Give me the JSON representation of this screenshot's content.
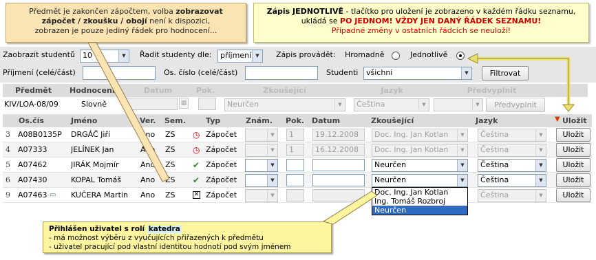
{
  "callout_left": {
    "line1a": "Předmět je zakončen zápočtem, volba ",
    "line1b": "zobrazovat",
    "line2": "zápočet / zkoušku / obojí",
    "line2b": " není k dispozici,",
    "line3": "zobrazen je pouze jediný řádek pro hodnocení..."
  },
  "callout_right": {
    "line1a": "Zápis JEDNOTLIVĚ",
    "line1b": " - tlačítko pro uložení je zobrazeno v každém řádku seznamu,",
    "line2a": "ukládá se ",
    "line2b": "PO JEDNOM! VŽDY JEN DANÝ ŘÁDEK SEZNAMU!",
    "line3": "Případné změny v ostatních řádcích se neuloží!"
  },
  "filters": {
    "show_label": "Zaobrazit studentů",
    "show_value": "10",
    "sort_label": "Řadit studenty dle:",
    "sort_value": "příjmení",
    "mode_label": "Zápis provádět:",
    "mode_bulk": "Hromadně",
    "mode_single": "Jednotlivě",
    "surname_label": "Příjmení (celé/část)",
    "surname_value": "",
    "id_label": "Os. číslo (celé/část)",
    "id_value": "",
    "students_label": "Studenti",
    "students_value": "všichni",
    "filter_button": "Filtrovat"
  },
  "prefill": {
    "headers": [
      "Předmět",
      "Hodnocení",
      "Datum",
      "Pok.",
      "Zkoušející",
      "Jazyk",
      "Předvyplnit"
    ],
    "subject": "KIV/LOA-08/09",
    "grade": "Slovně",
    "date": "",
    "attempt": "",
    "examiner": "Neurčen",
    "language": "Čeština",
    "prefill_select": "",
    "prefill_button": "Předvyplnit"
  },
  "table": {
    "headers": [
      "Os.čís",
      "Jméno",
      "Ver.",
      "Sem.",
      "Typ",
      "Znám.",
      "Pok.",
      "Datum",
      "Zkoušející",
      "Jazyk",
      "Uložit"
    ],
    "rows": [
      {
        "idx": "3",
        "id": "A08B0135P",
        "name": "DRGÁČ Jiří",
        "ver": "Ano",
        "sem": "ZS",
        "status": "clock-icon",
        "typ": "Zápočet",
        "grade": "",
        "attempt": "1",
        "date": "19.12.2008",
        "examiner": "Doc. Ing. Jan Kotlan",
        "language": "Čeština",
        "save": "Uložit",
        "locked": true
      },
      {
        "idx": "4",
        "id": "A07333",
        "name": "JELÍNEK Jan",
        "ver": "Ano",
        "sem": "ZS",
        "status": "clock-icon",
        "typ": "Zápočet",
        "grade": "",
        "attempt": "1",
        "date": "16.12.2008",
        "examiner": "Doc. Ing. Jan Kotlan",
        "language": "Čeština",
        "save": "Uložit",
        "locked": true
      },
      {
        "idx": "5",
        "id": "A07462",
        "name": "JIRÁK Mojmír",
        "ver": "Ano",
        "sem": "ZS",
        "status": "check-icon",
        "typ": "Zápočet",
        "grade": "",
        "attempt": "",
        "date": "",
        "examiner": "Neurčen",
        "language": "Čeština",
        "save": "Uložit",
        "locked": false
      },
      {
        "idx": "6",
        "id": "A07430",
        "name": "KOPAL Tomáš",
        "ver": "Ano",
        "sem": "ZS",
        "status": "check-icon",
        "typ": "Zápočet",
        "grade": "",
        "attempt": "",
        "date": "",
        "examiner": "Neurčen",
        "language": "Čeština",
        "save": "Uložit",
        "locked": false
      },
      {
        "idx": "9",
        "id": "A07463",
        "name": "KUČERA Martin",
        "ver": "Ano",
        "sem": "ZS",
        "status": "cross-icon",
        "typ": "Zápočet",
        "grade": "",
        "attempt": "",
        "date": "",
        "examiner": "",
        "language": "Čeština",
        "save": "Uložit",
        "locked": true
      }
    ]
  },
  "examiner_dropdown": {
    "options": [
      "Doc. Ing. Jan Kotlan",
      "Ing. Tomáš Rozbroj",
      "Neurčen"
    ],
    "selected_index": 2
  },
  "note_user": {
    "line1a": "Přihlášen uživatel s rolí ",
    "line1b": "katedra",
    "line2": "- má možnost výběru z vyučujících přiřazených k předmětu",
    "line3": "- uživatel pracující pod vlastní identitou hodnotí pod svým jménem"
  },
  "colors": {
    "band": "#e6e6e6",
    "callout_tip": "#fbe4b4",
    "callout_warn": "#ffffcc",
    "note": "#fdf5a0",
    "warn_red": "#cc0000",
    "selection_blue": "#316ac5"
  }
}
